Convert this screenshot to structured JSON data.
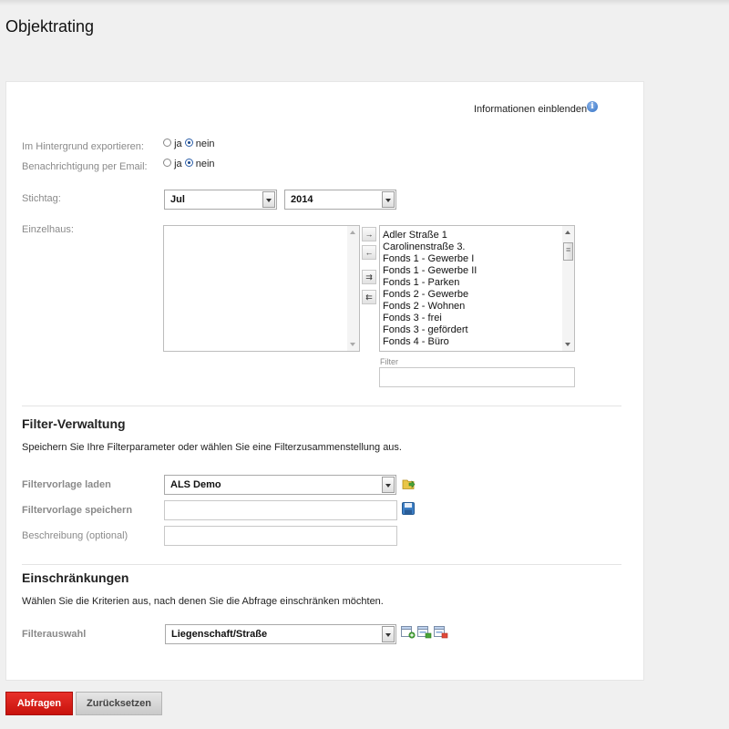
{
  "page": {
    "title": "Objektrating"
  },
  "info": {
    "label": "Informationen einblenden",
    "icon": "info-icon"
  },
  "options": {
    "export_background": {
      "label": "Im Hintergrund exportieren:",
      "yes": "ja",
      "no": "nein",
      "selected": "nein"
    },
    "notify_email": {
      "label": "Benachrichtigung per Email:",
      "yes": "ja",
      "no": "nein",
      "selected": "nein"
    }
  },
  "stichtag": {
    "label": "Stichtag:",
    "month": "Jul",
    "year": "2014"
  },
  "einzelhaus": {
    "label": "Einzelhaus:",
    "available": [
      "Adler Straße 1",
      "Carolinenstraße 3.",
      "Fonds 1 - Gewerbe I",
      "Fonds 1 - Gewerbe II",
      "Fonds 1 - Parken",
      "Fonds 2 - Gewerbe",
      "Fonds 2 - Wohnen",
      "Fonds 3 - frei",
      "Fonds 3 - gefördert",
      "Fonds 4 - Büro"
    ],
    "filter_label": "Filter",
    "filter_value": "",
    "move_buttons": {
      "add": "→",
      "remove": "←",
      "add_all": "⇉",
      "remove_all": "⇇"
    }
  },
  "filter_verwaltung": {
    "heading": "Filter-Verwaltung",
    "description": "Speichern Sie Ihre Filterparameter oder wählen Sie eine Filterzusammenstellung aus.",
    "load_label": "Filtervorlage laden",
    "load_value": "ALS Demo",
    "save_label": "Filtervorlage speichern",
    "save_value": "",
    "desc_label": "Beschreibung (optional)",
    "desc_value": ""
  },
  "einschraenkungen": {
    "heading": "Einschränkungen",
    "description": "Wählen Sie die Kriterien aus, nach denen Sie die Abfrage einschränken möchten.",
    "filter_label": "Filterauswahl",
    "filter_value": "Liegenschaft/Straße"
  },
  "actions": {
    "query": "Abfragen",
    "reset": "Zurücksetzen"
  },
  "colors": {
    "primary": "#d81e17",
    "accent": "#2f6fc4"
  }
}
